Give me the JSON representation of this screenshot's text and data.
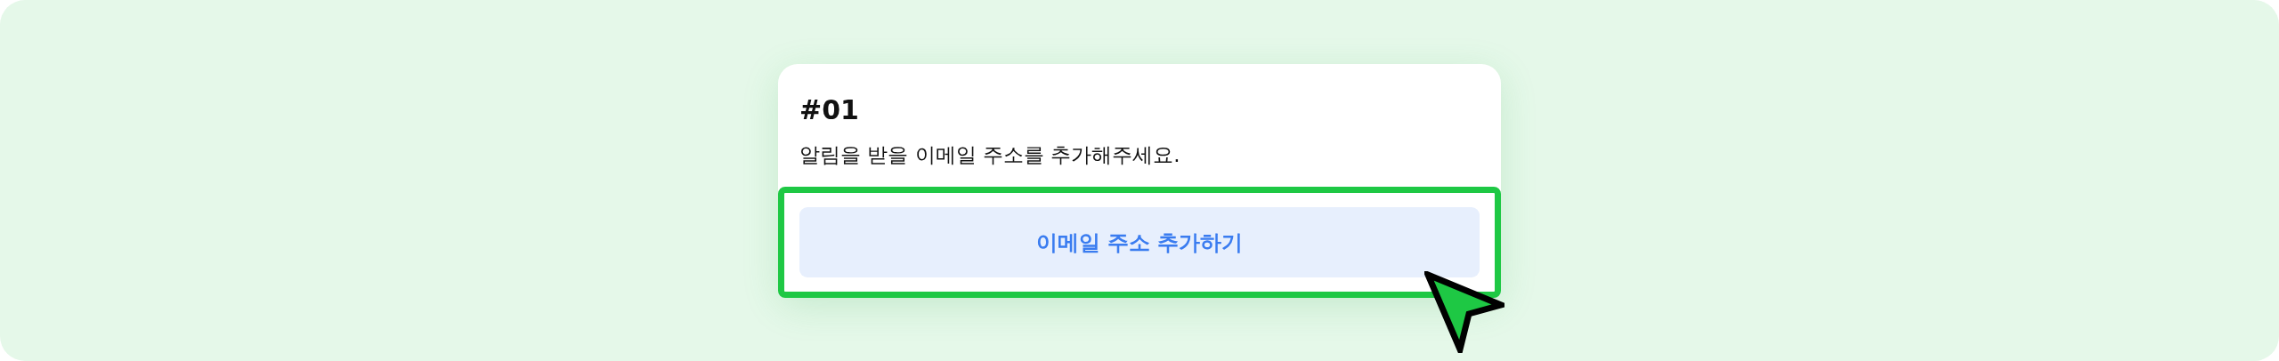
{
  "card": {
    "title": "#01",
    "description": "알림을 받을 이메일 주소를 추가해주세요.",
    "button": {
      "label": "이메일 주소 추가하기",
      "highlighted": true
    }
  }
}
